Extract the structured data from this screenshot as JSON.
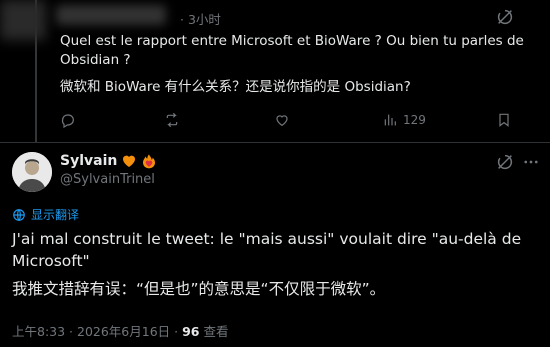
{
  "reply": {
    "time": "· 3小时",
    "text_fr_line1": "Quel est le rapport entre Microsoft et BioWare ? Ou bien tu parles de",
    "text_fr_line2": "Obsidian ?",
    "text_zh": "微软和 BioWare 有什么关系？还是说你指的是 Obsidian?",
    "actions": {
      "reply_count": "",
      "retweet_count": "",
      "like_count": "",
      "views_count": "129"
    }
  },
  "main": {
    "author_name": "Sylvain",
    "author_handle": "@SylvainTrinel",
    "emojis": [
      "orange-heart",
      "heart-on-fire"
    ],
    "translate_label": "显示翻译",
    "text_fr_line1": "J'ai mal construit le tweet: le \"mais aussi\" voulait dire \"au-delà de",
    "text_fr_line2": "Microsoft\"",
    "text_zh": "我推文措辞有误：“但是也”的意思是“不仅限于微软”。",
    "timestamp": "上午8:33 · 2026年6月16日 · ",
    "views_count": "96",
    "views_label": " 查看"
  },
  "colors": {
    "background": "#000000",
    "text": "#e7e9ea",
    "muted": "#71767b",
    "accent": "#1d9bf0",
    "divider": "#2f3336"
  }
}
